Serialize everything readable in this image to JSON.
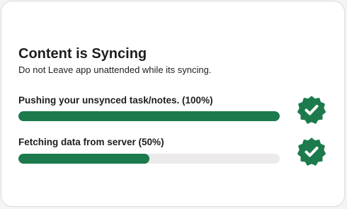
{
  "dialog": {
    "title": "Content is Syncing",
    "subtitle": "Do not Leave app unattended while its syncing."
  },
  "tasks": [
    {
      "label": "Pushing your unsynced task/notes. (100%)",
      "progress": 1.0,
      "status_icon": "verified-check-icon"
    },
    {
      "label": "Fetching data from server (50%)",
      "progress": 0.5,
      "status_icon": "verified-check-icon"
    }
  ],
  "colors": {
    "accent": "#1c7a4c",
    "track": "#eceaea",
    "text": "#1d1d1d"
  }
}
